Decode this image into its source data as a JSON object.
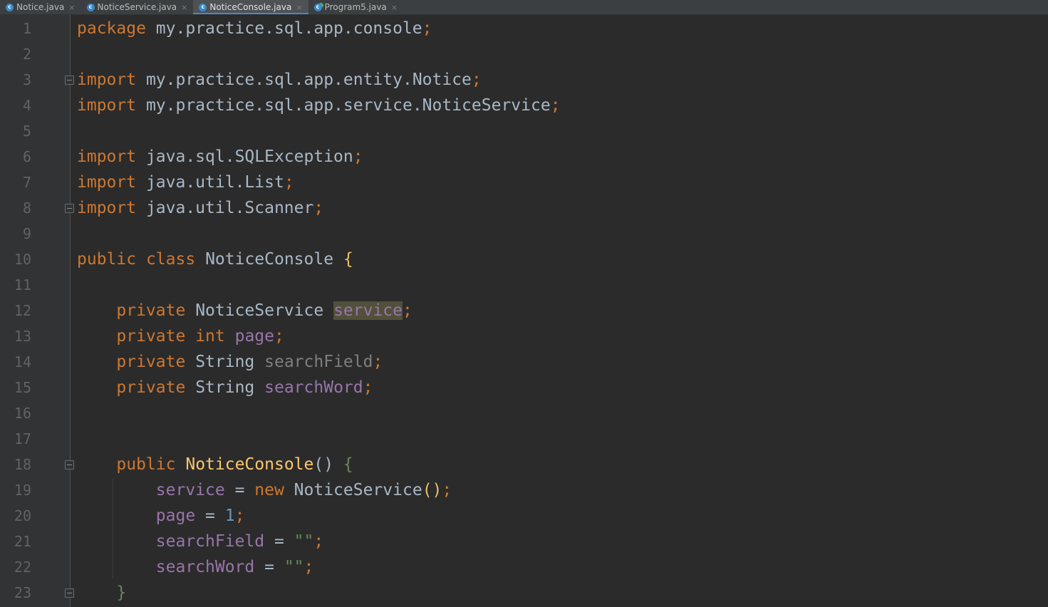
{
  "tabs": [
    {
      "label": "Notice.java",
      "icon": "class-icon",
      "active": false
    },
    {
      "label": "NoticeService.java",
      "icon": "class-icon",
      "active": false
    },
    {
      "label": "NoticeConsole.java",
      "icon": "class-icon",
      "active": true
    },
    {
      "label": "Program5.java",
      "icon": "runnable-class-icon",
      "active": false
    }
  ],
  "close_glyph": "×",
  "colors": {
    "background": "#2b2b2b",
    "gutter": "#313335",
    "keyword": "#cc7832",
    "field": "#9876aa",
    "method": "#ffc66d",
    "string": "#6a8759",
    "number": "#6897bb",
    "text": "#a9b7c6",
    "line_number": "#606366"
  },
  "editor": {
    "line_numbers": [
      "1",
      "2",
      "3",
      "4",
      "5",
      "6",
      "7",
      "8",
      "9",
      "10",
      "11",
      "12",
      "13",
      "14",
      "15",
      "16",
      "17",
      "18",
      "19",
      "20",
      "21",
      "22",
      "23"
    ],
    "lines": {
      "l1": {
        "kw": "package",
        "rest": " my.practice.sql.app.console",
        "semi": ";"
      },
      "l3": {
        "kw": "import",
        "rest": " my.practice.sql.app.entity.Notice",
        "semi": ";"
      },
      "l4": {
        "kw": "import",
        "rest": " my.practice.sql.app.service.NoticeService",
        "semi": ";"
      },
      "l6": {
        "kw": "import",
        "rest": " java.sql.SQLException",
        "semi": ";"
      },
      "l7": {
        "kw": "import",
        "rest": " java.util.List",
        "semi": ";"
      },
      "l8": {
        "kw": "import",
        "rest": " java.util.Scanner",
        "semi": ";"
      },
      "l10": {
        "kw1": "public",
        "kw2": "class",
        "name": "NoticeConsole",
        "brace": "{"
      },
      "l12": {
        "kw": "private",
        "type": "NoticeService",
        "field": "service",
        "semi": ";"
      },
      "l13": {
        "kw": "private",
        "type": "int",
        "field": "page",
        "semi": ";"
      },
      "l14": {
        "kw": "private",
        "type": "String",
        "field": "searchField",
        "semi": ";"
      },
      "l15": {
        "kw": "private",
        "type": "String",
        "field": "searchWord",
        "semi": ";"
      },
      "l18": {
        "kw": "public",
        "name": "NoticeConsole",
        "parens": "()",
        "brace": "{"
      },
      "l19": {
        "field": "service",
        "eq": " = ",
        "kw": "new",
        "type": " NoticeService",
        "parens": "()",
        "semi": ";"
      },
      "l20": {
        "field": "page",
        "eq": " = ",
        "num": "1",
        "semi": ";"
      },
      "l21": {
        "field": "searchField",
        "eq": " = ",
        "str": "\"\"",
        "semi": ";"
      },
      "l22": {
        "field": "searchWord",
        "eq": " = ",
        "str": "\"\"",
        "semi": ";"
      },
      "l23": {
        "brace": "}"
      }
    }
  }
}
